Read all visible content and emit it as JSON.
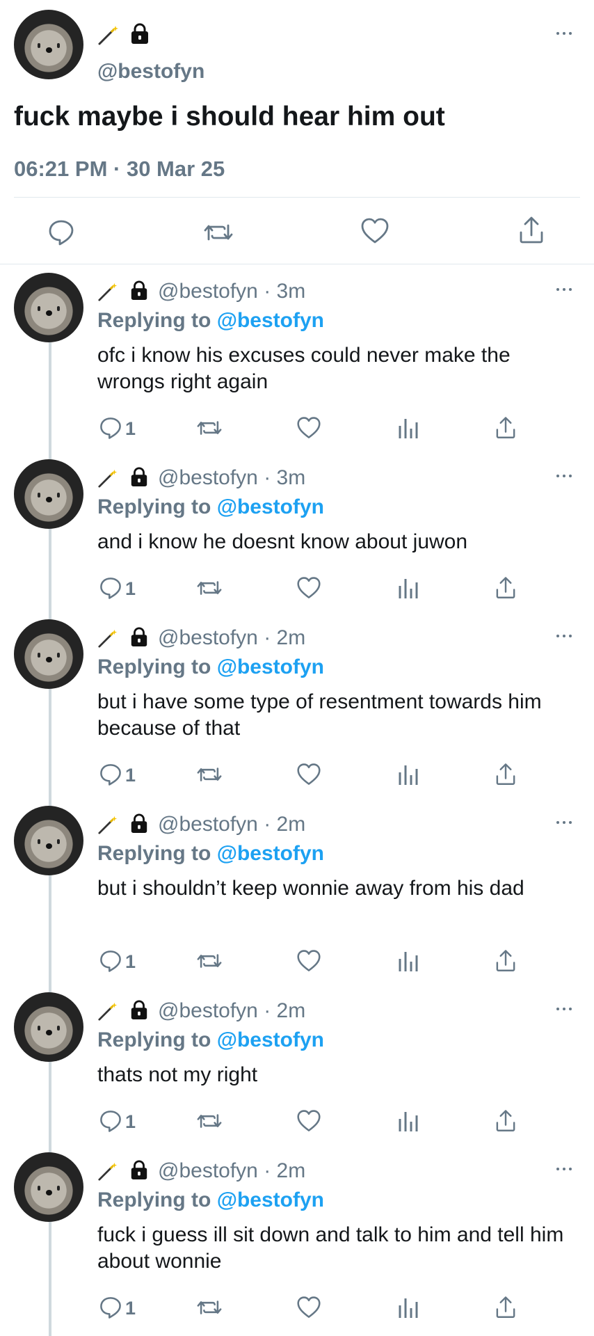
{
  "main_tweet": {
    "handle": "@bestofyn",
    "text": "fuck maybe i should hear him out",
    "timestamp": "06:21 PM · 30 Mar 25"
  },
  "replies": [
    {
      "handle_time": "@bestofyn · 3m",
      "replying_label": "Replying to",
      "replying_handle": "@bestofyn",
      "text": "ofc i know his excuses could never make the wrongs right again",
      "reply_count": "1"
    },
    {
      "handle_time": "@bestofyn · 3m",
      "replying_label": "Replying to",
      "replying_handle": "@bestofyn",
      "text": "and i know he doesnt know about juwon",
      "reply_count": "1"
    },
    {
      "handle_time": "@bestofyn · 2m",
      "replying_label": "Replying to",
      "replying_handle": "@bestofyn",
      "text": "but i have some type of resentment towards him because of that",
      "reply_count": "1"
    },
    {
      "handle_time": "@bestofyn · 2m",
      "replying_label": "Replying to",
      "replying_handle": "@bestofyn",
      "text": "but i shouldn’t keep wonnie away from his dad",
      "reply_count": "1"
    },
    {
      "handle_time": "@bestofyn · 2m",
      "replying_label": "Replying to",
      "replying_handle": "@bestofyn",
      "text": "thats not my right",
      "reply_count": "1"
    },
    {
      "handle_time": "@bestofyn · 2m",
      "replying_label": "Replying to",
      "replying_handle": "@bestofyn",
      "text": "fuck i guess ill sit down and talk to him and tell him about wonnie",
      "reply_count": "1"
    }
  ],
  "icons": {
    "reply": "reply-icon",
    "retweet": "retweet-icon",
    "like": "heart-icon",
    "analytics": "analytics-icon",
    "share": "share-icon",
    "wand": "magic-wand-icon",
    "lock": "lock-icon",
    "more": "more-icon"
  },
  "colors": {
    "text": "#14171a",
    "secondary": "#657786",
    "mention": "#1da1f2",
    "divider": "#e1e8ed"
  }
}
